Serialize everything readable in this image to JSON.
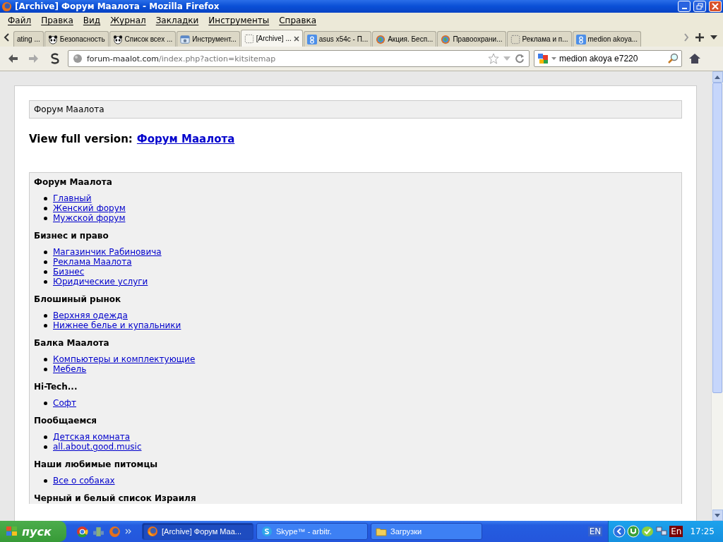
{
  "window": {
    "title": "[Archive] Форум Маалота - Mozilla Firefox"
  },
  "menu": [
    "Файл",
    "Правка",
    "Вид",
    "Журнал",
    "Закладки",
    "Инструменты",
    "Справка"
  ],
  "tabs": [
    {
      "label": "ating ...",
      "kind": "none",
      "selected": false
    },
    {
      "label": "Безопасность",
      "kind": "panda",
      "selected": false
    },
    {
      "label": "Список всех ...",
      "kind": "panda",
      "selected": false
    },
    {
      "label": "Инструмент...",
      "kind": "tool",
      "selected": false
    },
    {
      "label": "[Archive] ...",
      "kind": "blank",
      "selected": true
    },
    {
      "label": "asus x54c - П...",
      "kind": "google",
      "selected": false
    },
    {
      "label": "Акция. Бесп...",
      "kind": "globe",
      "selected": false
    },
    {
      "label": "Правоохрани...",
      "kind": "globe",
      "selected": false
    },
    {
      "label": "Реклама и п...",
      "kind": "blank",
      "selected": false
    },
    {
      "label": "medion akoya...",
      "kind": "google",
      "selected": false
    }
  ],
  "address": {
    "domain": "forum-maalot.com",
    "path": "/index.php?action=kitsitemap"
  },
  "search": {
    "value": "medion akoya e7220"
  },
  "breadcrumb": "Форум Маалота",
  "full_version": {
    "label": "View full version:",
    "link": "Форум Маалота"
  },
  "sections": [
    {
      "title": "Форум Маалота",
      "links": [
        "Главный",
        "Женский форум",
        "Мужской форум"
      ]
    },
    {
      "title": "Бизнес и право",
      "links": [
        "Магазинчик Рабиновича",
        "Реклама Маалота",
        "Бизнес",
        "Юридические услуги"
      ]
    },
    {
      "title": "Блошиный рынок",
      "links": [
        "Верхняя одежда",
        "Нижнее белье и купальники"
      ]
    },
    {
      "title": "Балка Маалота",
      "links": [
        "Компьютеры и комплектующие",
        "Мебель"
      ]
    },
    {
      "title": "Hi-Tech...",
      "links": [
        "Софт"
      ]
    },
    {
      "title": "Пообщаемся",
      "links": [
        "Детская комната",
        "all.about.good.music"
      ]
    },
    {
      "title": "Наши любимые питомцы",
      "links": [
        "Все о собаках"
      ]
    },
    {
      "title": "Черный и белый список Израиля"
    }
  ],
  "taskbar": {
    "start": "пуск",
    "tasks": [
      {
        "label": "[Archive] Форум Маа...",
        "kind": "firefox",
        "selected": true
      },
      {
        "label": "Skype™ - arbitr.",
        "kind": "skype",
        "selected": false
      },
      {
        "label": "Загрузки",
        "kind": "folder",
        "selected": false
      }
    ],
    "language": "EN",
    "tray_language": "En",
    "clock": "17:25"
  }
}
